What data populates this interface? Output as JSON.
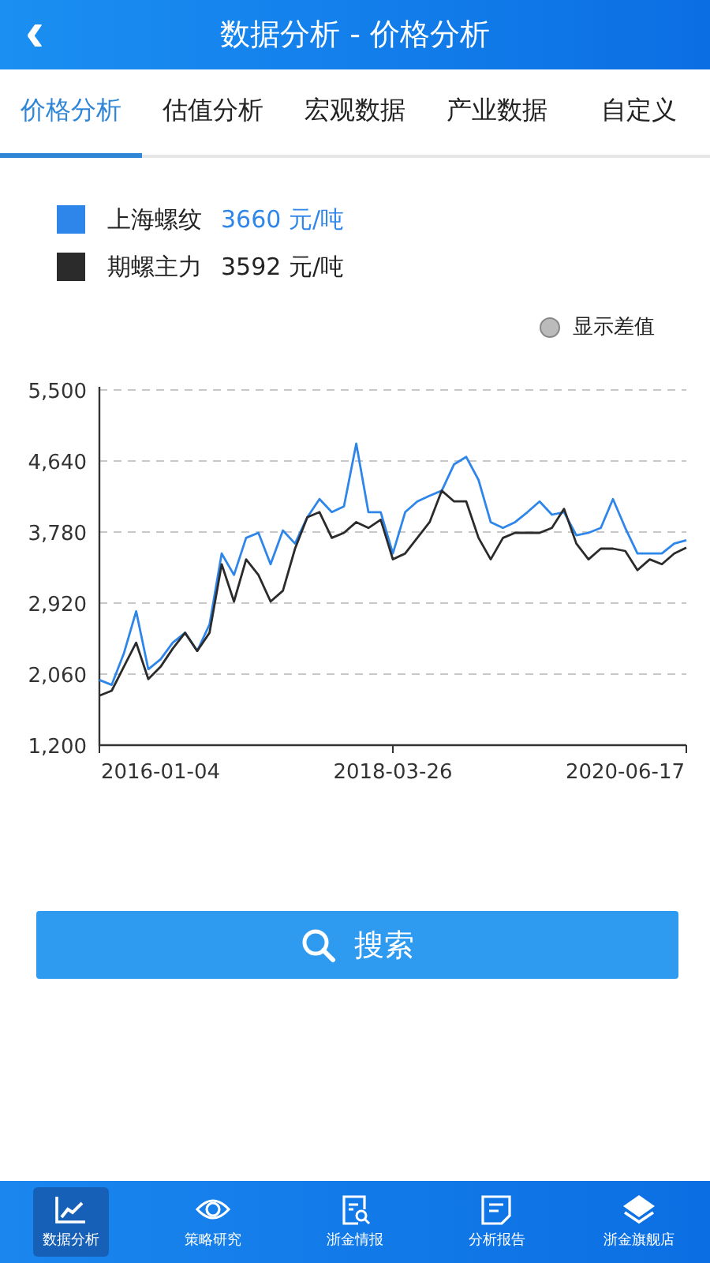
{
  "header": {
    "back_icon": "‹",
    "title": "数据分析 - 价格分析"
  },
  "tabs": [
    {
      "label": "价格分析",
      "selected": true
    },
    {
      "label": "估值分析",
      "selected": false
    },
    {
      "label": "宏观数据",
      "selected": false
    },
    {
      "label": "产业数据",
      "selected": false
    },
    {
      "label": "自定义",
      "selected": false
    }
  ],
  "legend": [
    {
      "name": "上海螺纹",
      "value": "3660 元/吨",
      "color": "#2f86ea"
    },
    {
      "name": "期螺主力",
      "value": "3592 元/吨",
      "color": "#2b2b2b"
    }
  ],
  "show_difference": {
    "label": "显示差值",
    "checked": false
  },
  "chart": {
    "chart_data": {
      "type": "line",
      "grid": true,
      "categories": [
        null,
        null,
        null,
        null,
        null,
        "2016-01-04",
        null,
        null,
        null,
        null,
        null,
        null,
        null,
        null,
        null,
        null,
        null,
        null,
        null,
        null,
        null,
        null,
        null,
        null,
        "2018-03-26",
        null,
        null,
        null,
        null,
        null,
        null,
        null,
        null,
        null,
        null,
        null,
        null,
        null,
        null,
        null,
        null,
        null,
        null,
        "2020-06-17",
        null,
        null,
        null,
        null,
        null
      ],
      "series": [
        {
          "color": "#2f86ea",
          "values": [
            1990,
            1930,
            2310,
            2820,
            2120,
            2240,
            2440,
            2560,
            2340,
            2660,
            3520,
            3260,
            3710,
            3770,
            3390,
            3800,
            3640,
            3960,
            4180,
            4020,
            4090,
            4850,
            4020,
            4020,
            3520,
            4020,
            4150,
            4220,
            4280,
            4600,
            4690,
            4410,
            3900,
            3830,
            3900,
            4020,
            4150,
            3990,
            4020,
            3740,
            3770,
            3830,
            4180,
            3830,
            3520,
            3520,
            3520,
            3640,
            3680
          ]
        },
        {
          "color": "#2b2b2b",
          "values": [
            1800,
            1860,
            2150,
            2440,
            2000,
            2150,
            2370,
            2560,
            2340,
            2560,
            3390,
            2940,
            3450,
            3260,
            2940,
            3070,
            3580,
            3960,
            4020,
            3710,
            3770,
            3900,
            3830,
            3930,
            3450,
            3520,
            3710,
            3900,
            4280,
            4150,
            4150,
            3710,
            3450,
            3710,
            3770,
            3770,
            3770,
            3830,
            4060,
            3640,
            3450,
            3580,
            3580,
            3550,
            3320,
            3450,
            3390,
            3520,
            3590
          ]
        }
      ],
      "ylim": [
        1200,
        5500
      ],
      "yticks": [
        {
          "value": 5500,
          "label": "5,500"
        },
        {
          "value": 4640,
          "label": "4,640"
        },
        {
          "value": 3780,
          "label": "3,780"
        },
        {
          "value": 2920,
          "label": "2,920"
        },
        {
          "value": 2060,
          "label": "2,060"
        },
        {
          "value": 1200,
          "label": "1,200"
        }
      ]
    }
  },
  "search_button": {
    "label": "搜索"
  },
  "bottom_nav": [
    {
      "label": "数据分析",
      "kind": "chart",
      "selected": true
    },
    {
      "label": "策略研究",
      "kind": "eye",
      "selected": false
    },
    {
      "label": "浙金情报",
      "kind": "doc-search",
      "selected": false
    },
    {
      "label": "分析报告",
      "kind": "doc",
      "selected": false
    },
    {
      "label": "浙金旗舰店",
      "kind": "layers",
      "selected": false
    }
  ]
}
